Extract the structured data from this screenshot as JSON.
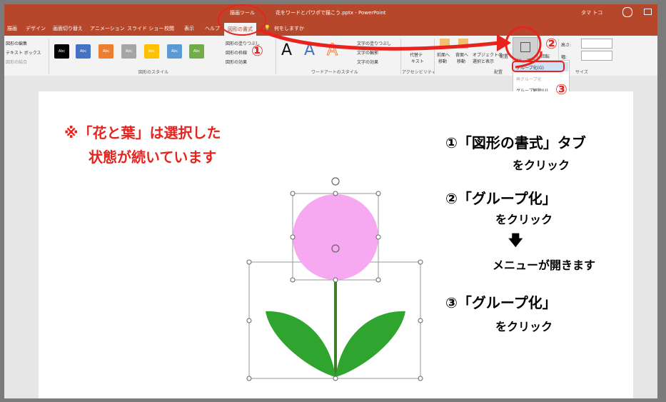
{
  "titlebar": {
    "contextual_label": "描画ツール",
    "document_title": "花をワードとパワポで描こう.pptx  -  PowerPoint",
    "user": "タマ トコ"
  },
  "tabs": [
    "描画",
    "デザイン",
    "画面切り替え",
    "アニメーション",
    "スライド ショー",
    "校閲",
    "表示",
    "ヘルプ",
    "図形の書式"
  ],
  "tell_me": "何をしますか",
  "ribbon": {
    "left_items": [
      "図形の編集",
      "テキスト ボックス",
      "図形の結合"
    ],
    "style_swatch_label": "Abc",
    "group_shape_styles": "図形のスタイル",
    "fill": "図形の塗りつぶし",
    "outline": "図形の枠線",
    "effects": "図形の効果",
    "wordart_letter": "A",
    "text_fill": "文字の塗りつぶし",
    "text_outline": "文字の輪郭",
    "text_effects": "文字の効果",
    "group_wordart": "ワードアートのスタイル",
    "alt_text_1": "代替テ",
    "alt_text_2": "キスト",
    "group_accessibility": "アクセシビリティ",
    "bring_forward_1": "前面へ",
    "bring_forward_2": "移動",
    "send_back_1": "背面へ",
    "send_back_2": "移動",
    "objects_1": "オブジェクトの",
    "objects_2": "選択と表示",
    "align": "配置",
    "group_btn": "グループ化",
    "rotate": "回転",
    "group_arrange": "配置",
    "height_label": "高さ:",
    "width_label": "幅:",
    "group_size": "サイズ"
  },
  "group_menu": {
    "item_group": "グループ化(G)",
    "item_regroup": "再グループ化",
    "item_ungroup": "グループ解除(U)"
  },
  "callout_numbers": [
    "①",
    "②",
    "③"
  ],
  "slide": {
    "red_note_line1": "※「花と葉」は選択した",
    "red_note_line2": "状態が続いています",
    "step1_title": "①「図形の書式」タブ",
    "step1_sub": "をクリック",
    "step2_title": "②「グループ化」",
    "step2_sub": "をクリック",
    "down_arrow": "🡇",
    "step2_note": "メニューが開きます",
    "step3_title": "③「グループ化」",
    "step3_sub": "をクリック"
  },
  "colors": {
    "accent": "#b7472a",
    "callout_red": "#e8231d",
    "flower": "#f6a8f0",
    "leaf": "#2fa52f",
    "stem": "#3e7d2c",
    "swatches": [
      "#000000",
      "#4472c4",
      "#ed7d31",
      "#a5a5a5",
      "#ffc000",
      "#5b9bd5",
      "#70ad47"
    ]
  }
}
